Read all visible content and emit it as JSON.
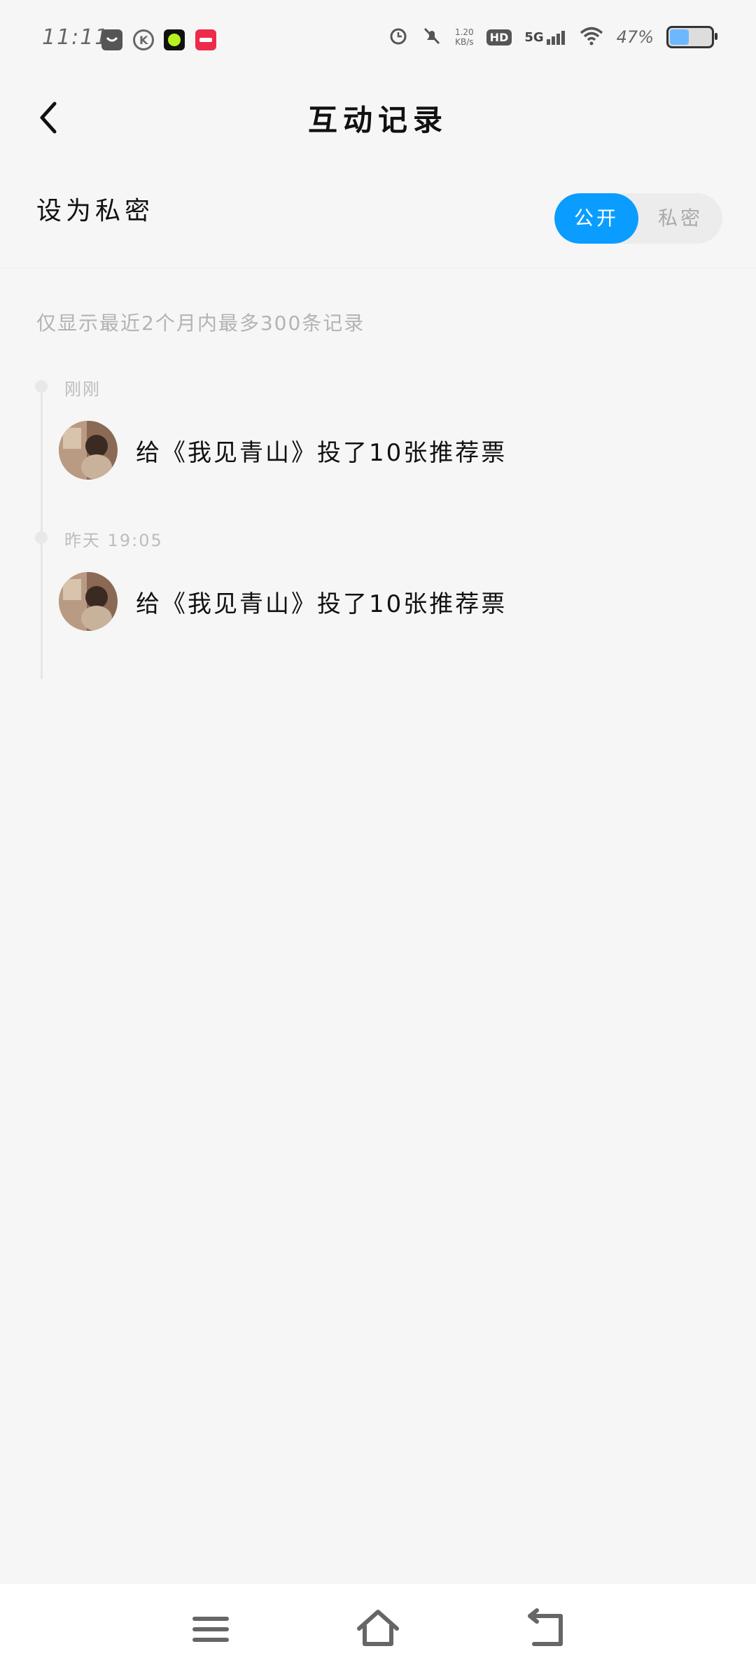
{
  "status_bar": {
    "time": "11:11",
    "speed_value": "1.20",
    "speed_unit": "KB/s",
    "hd": "HD",
    "network": "5G",
    "battery_pct": "47%",
    "battery_level": 0.47
  },
  "header": {
    "title": "互动记录"
  },
  "privacy": {
    "label": "设为私密",
    "options": [
      "公开",
      "私密"
    ],
    "selected": "公开"
  },
  "notice": "仅显示最近2个月内最多300条记录",
  "records": [
    {
      "time": "刚刚",
      "text": "给《我见青山》投了10张推荐票"
    },
    {
      "time": "昨天 19:05",
      "text": "给《我见青山》投了10张推荐票"
    }
  ],
  "colors": {
    "accent": "#0a9dff",
    "background": "#f6f6f6"
  },
  "icons": {
    "back": "back-icon",
    "menu": "menu-icon",
    "home": "home-icon",
    "return": "return-icon"
  }
}
